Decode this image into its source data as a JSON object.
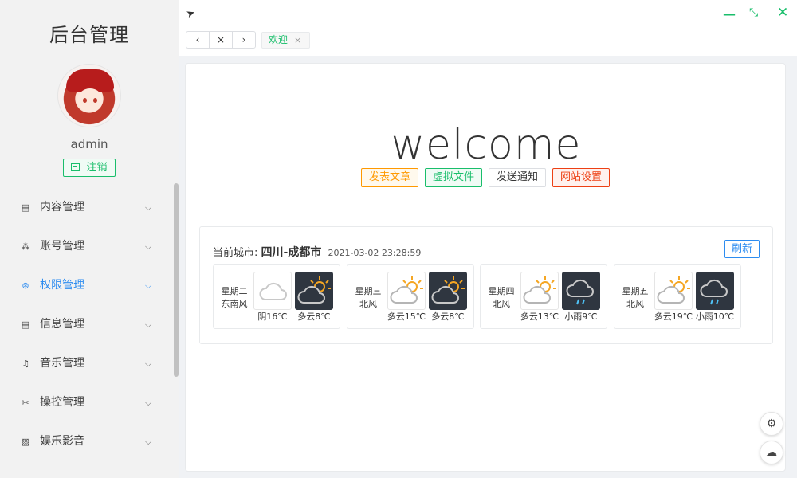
{
  "sidebar": {
    "title": "后台管理",
    "username": "admin",
    "logout_label": "注销",
    "items": [
      {
        "label": "内容管理",
        "icon": "document-icon",
        "glyph": "▤",
        "active": false
      },
      {
        "label": "账号管理",
        "icon": "users-icon",
        "glyph": "⁂",
        "active": false
      },
      {
        "label": "权限管理",
        "icon": "permission-icon",
        "glyph": "⊛",
        "active": true
      },
      {
        "label": "信息管理",
        "icon": "info-icon",
        "glyph": "▤",
        "active": false
      },
      {
        "label": "音乐管理",
        "icon": "music-icon",
        "glyph": "♫",
        "active": false
      },
      {
        "label": "操控管理",
        "icon": "tools-icon",
        "glyph": "✂",
        "active": false
      },
      {
        "label": "娱乐影音",
        "icon": "image-icon",
        "glyph": "▨",
        "active": false
      }
    ]
  },
  "topbar": {
    "nav_back": "‹",
    "nav_close": "×",
    "nav_forward": "›",
    "tag_label": "欢迎",
    "tag_close": "×"
  },
  "main": {
    "welcome": "welcome",
    "buttons": [
      "发表文章",
      "虚拟文件",
      "发送通知",
      "网站设置"
    ]
  },
  "weather": {
    "label": "当前城市:",
    "city": "四川-成都市",
    "time": "2021-03-02 23:28:59",
    "refresh_label": "刷新",
    "days": [
      {
        "day": "星期二",
        "wind": "东南风",
        "day_text": "阴16℃",
        "night_text": "多云8℃",
        "day_icon": "overcast",
        "night_icon": "cloudy-night"
      },
      {
        "day": "星期三",
        "wind": "北风",
        "day_text": "多云15℃",
        "night_text": "多云8℃",
        "day_icon": "partly-cloudy",
        "night_icon": "cloudy-night"
      },
      {
        "day": "星期四",
        "wind": "北风",
        "day_text": "多云13℃",
        "night_text": "小雨9℃",
        "day_icon": "partly-cloudy",
        "night_icon": "rain-night"
      },
      {
        "day": "星期五",
        "wind": "北风",
        "day_text": "多云19℃",
        "night_text": "小雨10℃",
        "day_icon": "partly-cloudy",
        "night_icon": "rain-night"
      }
    ]
  },
  "colors": {
    "accent_blue": "#2d8cf0",
    "accent_green": "#19be6b",
    "warning": "#ff9900",
    "danger": "#ed4014"
  }
}
